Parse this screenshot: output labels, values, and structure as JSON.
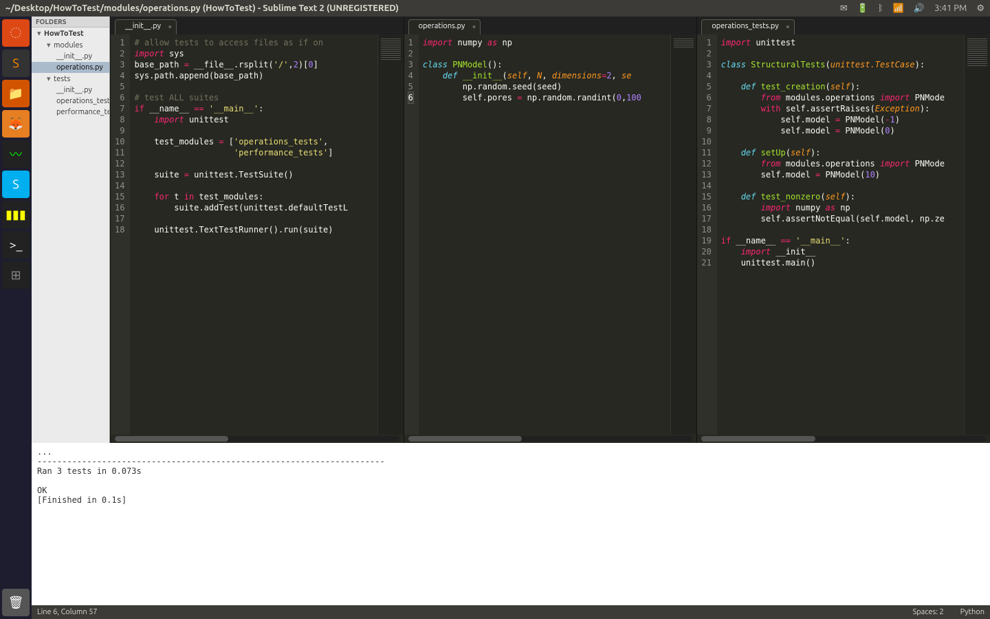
{
  "menubar": {
    "title": "~/Desktop/HowToTest/modules/operations.py (HowToTest) - Sublime Text 2 (UNREGISTERED)",
    "time": "3:41 PM"
  },
  "launcher": {
    "icons": [
      "ubuntu",
      "sublime",
      "files",
      "firefox",
      "sysmon",
      "skype",
      "colors",
      "terminal",
      "workspace"
    ],
    "trash": "trash"
  },
  "sidebar": {
    "header": "FOLDERS",
    "project": "HowToTest",
    "folders": [
      {
        "name": "modules",
        "files": [
          "__init__.py",
          "operations.py"
        ],
        "selected_file": "operations.py"
      },
      {
        "name": "tests",
        "files": [
          "__init__.py",
          "operations_tests.py",
          "performance_tests.py"
        ]
      }
    ]
  },
  "panes": [
    {
      "tab": "__init__.py",
      "code_html": "<span class='cmt'># allow tests to access files as if on</span>\n<span class='kw'>import</span> sys\nbase_path <span class='op'>=</span> __file__.rsplit(<span class='str'>'/'</span>,<span class='num'>2</span>)[<span class='num'>0</span>]\nsys.path.append(base_path)\n\n<span class='cmt'># test ALL suites</span>\n<span class='kw2'>if</span> __name__ <span class='op'>==</span> <span class='str'>'__main__'</span>:\n    <span class='kw'>import</span> unittest\n\n    test_modules <span class='op'>=</span> [<span class='str'>'operations_tests'</span>,\n                    <span class='str'>'performance_tests'</span>]\n\n    suite <span class='op'>=</span> unittest.TestSuite()\n\n    <span class='kw2'>for</span> t <span class='kw2'>in</span> test_modules:\n        suite.addTest(unittest.defaultTestL\n\n    unittest.TextTestRunner().run(suite)",
      "line_count": 18
    },
    {
      "tab": "operations.py",
      "code_html": "<span class='kw'>import</span> numpy <span class='kw'>as</span> np\n\n<span class='cls'>class</span> <span class='fn'>PNModel</span>():\n    <span class='def'>def</span> <span class='fn'>__init__</span>(<span class='self'>self</span>, <span class='arg'>N</span>, <span class='arg'>dimensions</span><span class='op'>=</span><span class='num'>2</span>, <span class='arg'>se</span>\n        np.random.seed(seed)\n        self.pores <span class='op'>=</span> np.random.randint(<span class='num'>0</span>,<span class='num'>100</span>",
      "line_count": 6,
      "highlight_line": 6
    },
    {
      "tab": "operations_tests.py",
      "code_html": "<span class='kw'>import</span> unittest\n\n<span class='cls'>class</span> <span class='fn'>StructuralTests</span>(<span class='arg'>unittest.TestCase</span>):\n\n    <span class='def'>def</span> <span class='fn'>test_creation</span>(<span class='self'>self</span>):\n        <span class='kw'>from</span> modules.operations <span class='kw'>import</span> PNMode\n        <span class='kw2'>with</span> self.assertRaises(<span class='arg'>Exception</span>):\n            self.model <span class='op'>=</span> PNModel(<span class='op'>-</span><span class='num'>1</span>)\n            self.model <span class='op'>=</span> PNModel(<span class='num'>0</span>)\n\n    <span class='def'>def</span> <span class='fn'>setUp</span>(<span class='self'>self</span>):\n        <span class='kw'>from</span> modules.operations <span class='kw'>import</span> PNMode\n        self.model <span class='op'>=</span> PNModel(<span class='num'>10</span>)\n\n    <span class='def'>def</span> <span class='fn'>test_nonzero</span>(<span class='self'>self</span>):\n        <span class='kw'>import</span> numpy <span class='kw'>as</span> np\n        self.assertNotEqual(self.model, np.ze\n\n<span class='kw2'>if</span> __name__ <span class='op'>==</span> <span class='str'>'__main__'</span>:\n    <span class='kw'>import</span> __init__\n    unittest.main()",
      "line_count": 21
    }
  ],
  "console_text": "...\n----------------------------------------------------------------------\nRan 3 tests in 0.073s\n\nOK\n[Finished in 0.1s]",
  "statusbar": {
    "position": "Line 6, Column 57",
    "spaces": "Spaces: 2",
    "syntax": "Python"
  }
}
